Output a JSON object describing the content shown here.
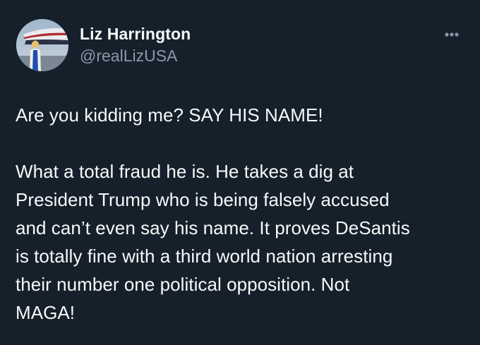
{
  "colors": {
    "background": "#15202b",
    "primary_text": "#f7f9f9",
    "secondary_text": "#8b98a5"
  },
  "tweet": {
    "author": {
      "display_name": "Liz Harrington",
      "handle": "@realLizUSA",
      "avatar_icon": "profile-photo"
    },
    "more_icon": "more-horizontal-icon",
    "paragraphs": [
      "Are you kidding me? SAY HIS NAME!",
      "What a total fraud he is. He takes a dig at\nPresident Trump who is being falsely accused\nand can’t even say his name. It proves DeSantis\nis totally fine with a third world nation arresting\ntheir number one political opposition. Not\nMAGA!"
    ]
  }
}
